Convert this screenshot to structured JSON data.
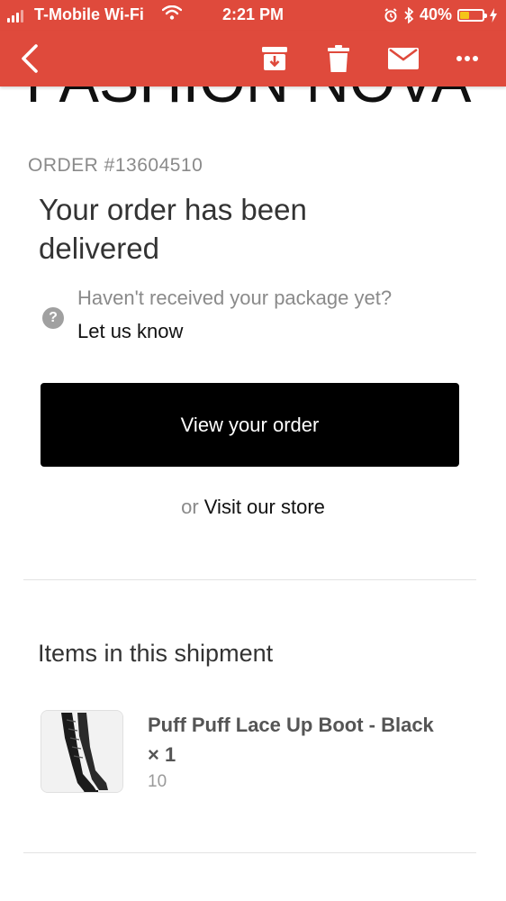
{
  "status_bar": {
    "carrier": "T-Mobile Wi-Fi",
    "time": "2:21 PM",
    "battery": "40%",
    "battery_level": 0.4,
    "icons": [
      "signal-icon",
      "wifi-icon",
      "alarm-icon",
      "bluetooth-icon",
      "battery-icon",
      "charging-icon"
    ]
  },
  "toolbar": {
    "icons": [
      "back-icon",
      "archive-icon",
      "trash-icon",
      "mail-icon",
      "more-icon"
    ],
    "accent_color": "#df4a3c"
  },
  "email": {
    "brand": "FASHION NOVA",
    "order_number": "ORDER #13604510",
    "headline": "Your order has been delivered",
    "help_question": "Haven't received your package yet?",
    "help_link": "Let us know",
    "primary_button": "View your order",
    "or_text": "or",
    "store_link": "Visit our store",
    "section_title": "Items in this shipment",
    "items": [
      {
        "name": "Puff Puff Lace Up Boot - Black × 1",
        "variant": "10"
      }
    ]
  }
}
